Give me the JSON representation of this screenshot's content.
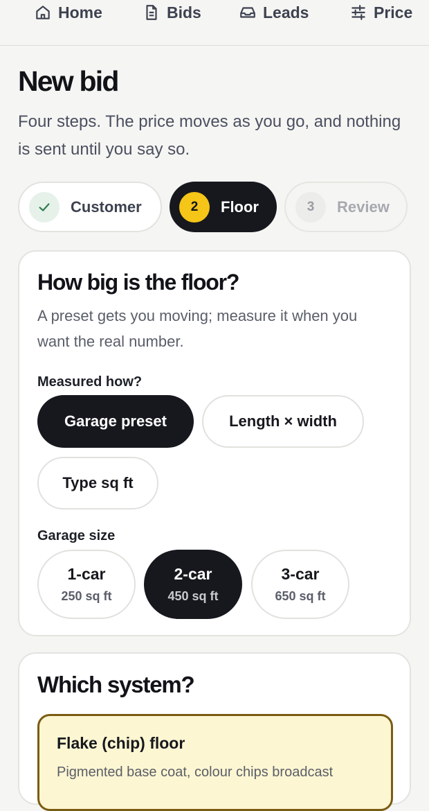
{
  "nav": {
    "items": [
      {
        "label": "Home",
        "icon": "home-icon"
      },
      {
        "label": "Bids",
        "icon": "document-icon"
      },
      {
        "label": "Leads",
        "icon": "inbox-icon"
      },
      {
        "label": "Price",
        "icon": "sliders-icon"
      }
    ]
  },
  "page": {
    "title": "New bid",
    "intro": "Four steps. The price moves as you go, and nothing is sent until you say so."
  },
  "steps": [
    {
      "label": "Customer",
      "badge": "",
      "state": "done",
      "icon": "check-icon"
    },
    {
      "label": "Floor",
      "badge": "2",
      "state": "active"
    },
    {
      "label": "Review",
      "badge": "3",
      "state": "upcoming"
    }
  ],
  "floor_card": {
    "title": "How big is the floor?",
    "subtitle": "A preset gets you moving; measure it when you want the real number.",
    "method_label": "Measured how?",
    "methods": [
      {
        "label": "Garage preset",
        "selected": true
      },
      {
        "label": "Length × width",
        "selected": false
      },
      {
        "label": "Type sq ft",
        "selected": false
      }
    ],
    "size_label": "Garage size",
    "sizes": [
      {
        "name": "1-car",
        "area": "250 sq ft",
        "selected": false
      },
      {
        "name": "2-car",
        "area": "450 sq ft",
        "selected": true
      },
      {
        "name": "3-car",
        "area": "650 sq ft",
        "selected": false
      }
    ]
  },
  "system_card": {
    "title": "Which system?",
    "options": [
      {
        "name": "Flake (chip) floor",
        "description": "Pigmented base coat, colour chips broadcast",
        "selected": true
      }
    ]
  },
  "colors": {
    "accent": "#f5c518",
    "ink": "#16181d",
    "background": "#f5f5f3",
    "success": "#2e7d4f",
    "selected_option_bg": "#fdf6d2",
    "selected_option_border": "#7a5c12"
  }
}
